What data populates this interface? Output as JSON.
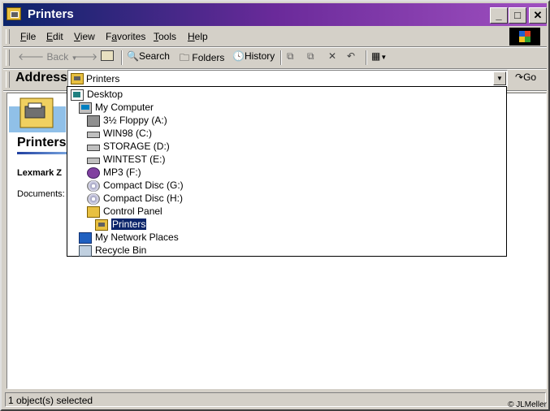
{
  "window": {
    "title": "Printers",
    "minimize": "_",
    "maximize": "□",
    "close": "✕"
  },
  "menu": [
    {
      "pre": "",
      "u": "F",
      "post": "ile"
    },
    {
      "pre": "",
      "u": "E",
      "post": "dit"
    },
    {
      "pre": "",
      "u": "V",
      "post": "iew"
    },
    {
      "pre": "F",
      "u": "a",
      "post": "vorites"
    },
    {
      "pre": "",
      "u": "T",
      "post": "ools"
    },
    {
      "pre": "",
      "u": "H",
      "post": "elp"
    }
  ],
  "toolbar": {
    "back": "Back",
    "search": "Search",
    "folders": "Folders",
    "history": "History"
  },
  "address": {
    "label": "Address",
    "value": "Printers",
    "go": "Go"
  },
  "pane": {
    "title": "Printers",
    "item": "Lexmark Z",
    "docs": "Documents: ("
  },
  "tree": [
    {
      "label": "Desktop",
      "icon": "desktop-icon",
      "level": 0
    },
    {
      "label": "My Computer",
      "icon": "my-computer-icon",
      "level": 1
    },
    {
      "label": "3½ Floppy (A:)",
      "icon": "floppy-drive-icon",
      "level": 2
    },
    {
      "label": "WIN98 (C:)",
      "icon": "hard-drive-icon",
      "level": 2
    },
    {
      "label": "STORAGE (D:)",
      "icon": "hard-drive-icon",
      "level": 2
    },
    {
      "label": "WINTEST (E:)",
      "icon": "hard-drive-icon",
      "level": 2
    },
    {
      "label": "MP3 (F:)",
      "icon": "mp3-drive-icon",
      "level": 2
    },
    {
      "label": "Compact Disc (G:)",
      "icon": "cd-drive-icon",
      "level": 2
    },
    {
      "label": "Compact Disc (H:)",
      "icon": "cd-drive-icon",
      "level": 2
    },
    {
      "label": "Control Panel",
      "icon": "control-panel-icon",
      "level": 2
    },
    {
      "label": "Printers",
      "icon": "printers-folder-icon",
      "level": 3,
      "selected": true
    },
    {
      "label": "My Network Places",
      "icon": "network-places-icon",
      "level": 1
    },
    {
      "label": "Recycle Bin",
      "icon": "recycle-bin-icon",
      "level": 1
    }
  ],
  "status": {
    "text": "1 object(s) selected",
    "copyright": "© JLMeller"
  }
}
